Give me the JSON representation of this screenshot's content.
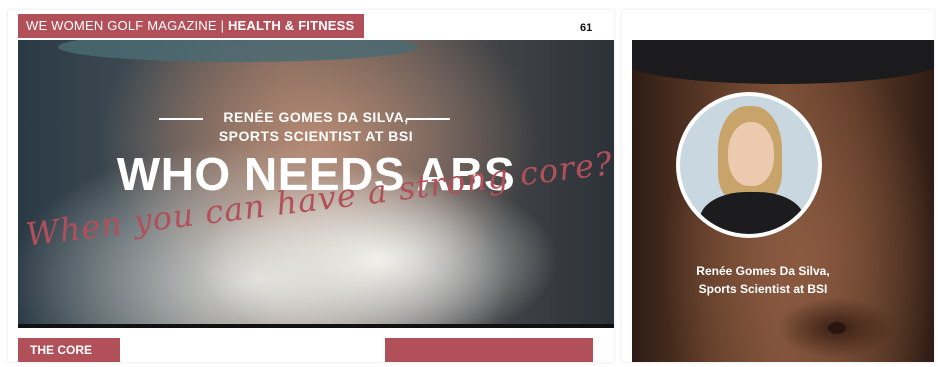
{
  "left_page": {
    "header": {
      "magazine": "WE WOMEN GOLF MAGAZINE",
      "separator": "|",
      "section": "HEALTH & FITNESS"
    },
    "page_number": "61",
    "hero": {
      "byline_line1": "RENÉE GOMES DA SILVA,",
      "byline_line2": "SPORTS SCIENTIST AT BSI",
      "headline": "WHO NEEDS ABS",
      "subheadline": "When you can have a strong core?"
    },
    "section_tag": "THE CORE"
  },
  "right_page": {
    "caption_line1": "Renée Gomes Da Silva,",
    "caption_line2": "Sports Scientist at BSI"
  },
  "colors": {
    "accent": "#b2505a"
  }
}
